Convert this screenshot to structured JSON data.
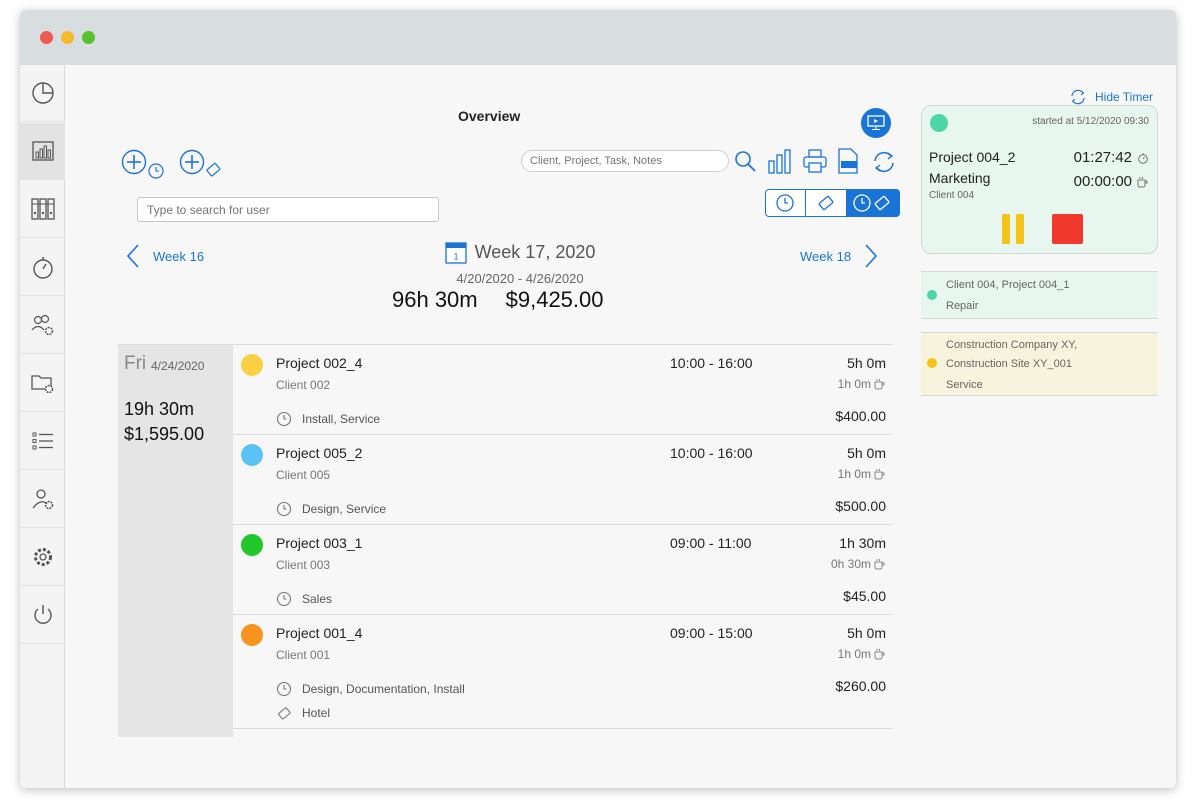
{
  "page": {
    "title": "Overview"
  },
  "colors": {
    "accent": "#1a74d8",
    "pause": "#f6c318",
    "stop": "#f0382d",
    "timer_bg": "#e7f6ef"
  },
  "sidebar": {
    "items": [
      {
        "icon": "pie-chart-icon"
      },
      {
        "icon": "bar-chart-icon",
        "active": true
      },
      {
        "icon": "binders-icon"
      },
      {
        "icon": "stopwatch-icon"
      },
      {
        "icon": "group-settings-icon"
      },
      {
        "icon": "folder-settings-icon"
      },
      {
        "icon": "list-icon"
      },
      {
        "icon": "user-settings-icon"
      },
      {
        "icon": "gear-icon"
      },
      {
        "icon": "power-icon"
      }
    ]
  },
  "toolbar": {
    "search_placeholder": "Client, Project, Task, Notes",
    "user_search_placeholder": "Type to search for user"
  },
  "week": {
    "prev_label": "Week 16",
    "next_label": "Week 18",
    "title": "Week 17, 2020",
    "calendar_day": "1",
    "range": "4/20/2020 - 4/26/2020",
    "total_hours": "96h 30m",
    "total_amount": "$9,425.00"
  },
  "day": {
    "name": "Fri",
    "date": "4/24/2020",
    "hours": "19h 30m",
    "amount": "$1,595.00"
  },
  "entries": [
    {
      "project": "Project 002_4",
      "client": "Client 002",
      "time": "10:00 - 16:00",
      "duration": "5h 0m",
      "break": "1h 0m",
      "tags": "Install, Service",
      "amount": "$400.00",
      "color": "#fbd144"
    },
    {
      "project": "Project 005_2",
      "client": "Client 005",
      "time": "10:00 - 16:00",
      "duration": "5h 0m",
      "break": "1h 0m",
      "tags": "Design, Service",
      "amount": "$500.00",
      "color": "#5bc2f5"
    },
    {
      "project": "Project 003_1",
      "client": "Client 003",
      "time": "09:00 - 11:00",
      "duration": "1h 30m",
      "break": "0h 30m",
      "tags": "Sales",
      "amount": "$45.00",
      "color": "#22c72a"
    },
    {
      "project": "Project 001_4",
      "client": "Client 001",
      "time": "09:00 - 15:00",
      "duration": "5h 0m",
      "break": "1h 0m",
      "tags": "Design, Documentation, Install",
      "expense": "Hotel",
      "amount": "$260.00",
      "color": "#f7931e"
    }
  ],
  "timer": {
    "hide_label": "Hide Timer",
    "started": "started at 5/12/2020 09:30",
    "project": "Project 004_2",
    "task": "Marketing",
    "client": "Client 004",
    "running": "01:27:42",
    "break": "00:00:00"
  },
  "recent": [
    {
      "line1": "Client 004, Project 004_1",
      "line2": "Repair",
      "color": "#4cd5a9"
    },
    {
      "line1": "Construction Company XY,",
      "line2": "Construction Site XY_001",
      "line3": "Service",
      "color": "#f6c318"
    }
  ]
}
